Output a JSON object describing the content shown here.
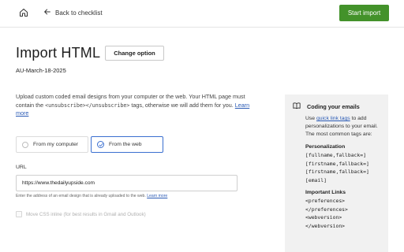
{
  "header": {
    "home_icon": "home-icon",
    "back_label": "Back to checklist",
    "start_import_label": "Start import",
    "start_import_color": "#43922a"
  },
  "main": {
    "title": "Import HTML",
    "change_option_label": "Change option",
    "subtitle": "AU-March-18-2025",
    "description": {
      "part1": "Upload custom coded email designs from your computer or the web. Your HTML page must contain the ",
      "code": "<unsubscribe></unsubscribe>",
      "part2": " tags, otherwise we will add them for you. ",
      "learn_more": "Learn more"
    },
    "source_options": [
      {
        "label": "From my computer",
        "selected": false
      },
      {
        "label": "From the web",
        "selected": true
      }
    ],
    "url_label": "URL",
    "url_value": "https://www.thedailyupside.com",
    "url_hint": "Enter the address of an email design that is already uploaded to the web. ",
    "url_hint_link": "Learn more",
    "move_css_label": "Move CSS inline (for best results in Gmail and Outlook)"
  },
  "panel": {
    "title": "Coding your emails",
    "intro_prefix": "Use ",
    "intro_link": "quick link tags",
    "intro_suffix": " to add personalizations to your email.",
    "common_tags": "The most common tags are:",
    "personalization_heading": "Personalization",
    "personalization_tags": [
      "[fullname,fallback=]",
      "[firstname,fallback=]",
      "[firstname,fallback=]",
      "[email]"
    ],
    "links_heading": "Important Links",
    "link_tags": [
      "<preferences>",
      "</preferences>",
      "<webversion>",
      "</webversion>"
    ]
  },
  "colors": {
    "accent_blue": "#3a6fd0",
    "link_blue": "#2b5bb5",
    "panel_bg": "#f1f1f1"
  }
}
